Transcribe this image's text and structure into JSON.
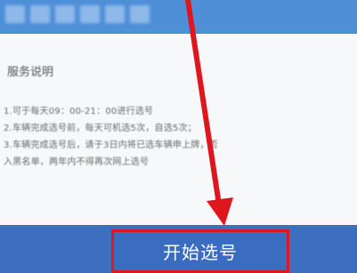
{
  "header": {
    "title": ""
  },
  "service_info": {
    "title": "服务说明",
    "rules": [
      "1.可于每天09：00-21：00进行选号",
      "2.车辆完成选号前，每天可机选5次，自选5次；",
      "3.车辆完成选号后，请于3日内将已选车辆申上牌，否",
      "入黑名单，两年内不得再次网上选号"
    ]
  },
  "actions": {
    "start_button_label": "开始选号"
  },
  "annotations": {
    "highlight_color": "#e0161f"
  }
}
